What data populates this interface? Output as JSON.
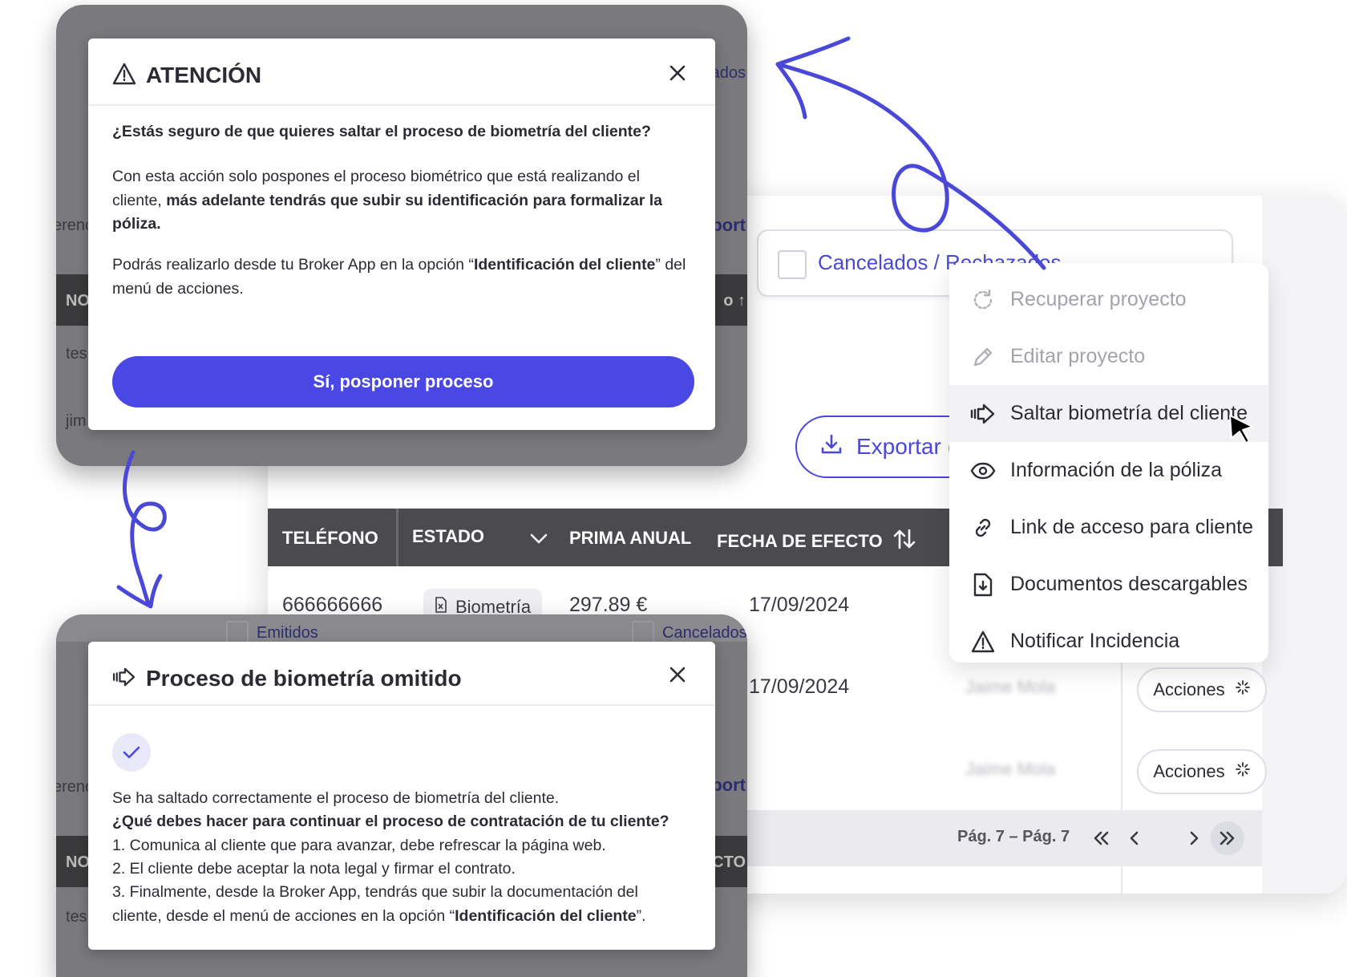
{
  "app": {
    "filter": {
      "label": "Cancelados / Rechazados"
    },
    "export_label": "Exportar (",
    "table": {
      "headers": {
        "phone": "TELÉFONO",
        "status": "ESTADO",
        "premium": "PRIMA ANUAL",
        "effective_date": "FECHA DE EFECTO"
      },
      "rows": [
        {
          "phone": "666666666",
          "status": "Biometría",
          "premium": "297.89 €",
          "date": "17/09/2024",
          "agent": ""
        },
        {
          "phone": "",
          "status": "",
          "premium": "",
          "date": "17/09/2024",
          "agent": "Jaime Mola"
        },
        {
          "phone": "",
          "status": "",
          "premium": "",
          "date": "",
          "agent": "Jaime Mola"
        }
      ],
      "actions_label": "Acciones"
    },
    "pager": {
      "text": "Pág. 7 – Pág. 7"
    }
  },
  "menu": {
    "items": [
      {
        "label": "Recuperar proyecto",
        "icon": "refresh-icon",
        "disabled": true
      },
      {
        "label": "Editar proyecto",
        "icon": "pencil-icon",
        "disabled": true
      },
      {
        "label": "Saltar biometría del cliente",
        "icon": "skip-arrow-icon",
        "hover": true
      },
      {
        "label": "Información de la póliza",
        "icon": "eye-icon"
      },
      {
        "label": "Link de acceso para cliente",
        "icon": "link-icon"
      },
      {
        "label": "Documentos descargables",
        "icon": "document-download-icon"
      },
      {
        "label": "Notificar Incidencia",
        "icon": "warning-icon"
      }
    ]
  },
  "modal_top": {
    "title": "ATENCIÓN",
    "question": "¿Estás seguro de que quieres saltar el proceso de biometría del cliente?",
    "p1_a": "Con esta acción solo pospones el proceso biométrico que está realizando el cliente, ",
    "p1_b": "más adelante tendrás que subir su identificación para formalizar la póliza.",
    "p2_a": "Podrás realizarlo desde tu Broker App en la opción “",
    "p2_b": "Identificación del cliente",
    "p2_c": "” del menú de acciones.",
    "button": "Sí, posponer proceso",
    "bg_fragments": {
      "f1": "ados",
      "f2": "erenc",
      "f3": "port",
      "f4": "NO",
      "f5": "o ↑",
      "f6": "tes",
      "f7": "jim"
    }
  },
  "modal_bottom": {
    "title": "Proceso de biometría omitido",
    "line1": "Se ha saltado correctamente el proceso de biometría del cliente.",
    "line2": "¿Qué debes hacer para continuar el proceso de contratación de tu cliente?",
    "step1": "1. Comunica al cliente que para avanzar, debe refrescar la página web.",
    "step2": "2. El cliente debe aceptar la nota legal y firmar el contrato.",
    "step3_a": "3. Finalmente, desde la Broker App, tendrás que subir la documentación del cliente, desde el menú de acciones en la opción “",
    "step3_b": "Identificación del cliente",
    "step3_c": "”.",
    "bg_fragments": {
      "f1": "Emitidos",
      "f2": "Cancelados",
      "f3": "erenc",
      "f4": "port",
      "f5": "NO",
      "f6": "CTO",
      "f7": "tes"
    }
  },
  "colors": {
    "accent": "#4a48e4",
    "arrow": "#4a48d8",
    "header_dark": "#4a4a4f"
  }
}
